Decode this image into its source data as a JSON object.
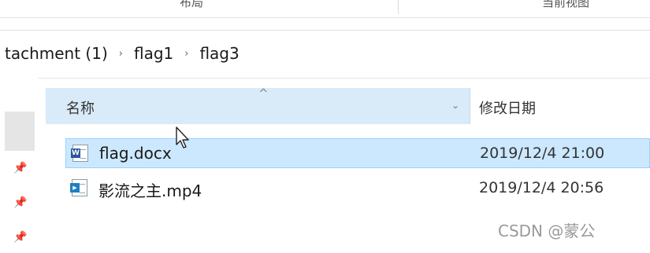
{
  "ribbon": {
    "group_left_label": "布局",
    "group_right_label": "当前视图"
  },
  "breadcrumb": {
    "segments": [
      "tachment (1)",
      "flag1",
      "flag3"
    ],
    "separator": "›"
  },
  "columns": {
    "name_label": "名称",
    "date_label": "修改日期",
    "sort_indicator": "^",
    "dropdown_glyph": "⌄"
  },
  "files": [
    {
      "name": "flag.docx",
      "date": "2019/12/4 21:00",
      "icon": "word-document-icon",
      "badge": "W",
      "badge_color": "#2b579a",
      "selected": true
    },
    {
      "name": "影流之主.mp4",
      "date": "2019/12/4 20:56",
      "icon": "video-file-icon",
      "badge": "▶",
      "badge_color": "#1f7ec1",
      "selected": false
    }
  ],
  "nav_pins": [
    "pin-icon",
    "pin-icon",
    "pin-icon"
  ],
  "watermark": "CSDN @蒙公",
  "colors": {
    "selection_bg": "#cce8ff",
    "header_bg": "#d9ebf9"
  }
}
